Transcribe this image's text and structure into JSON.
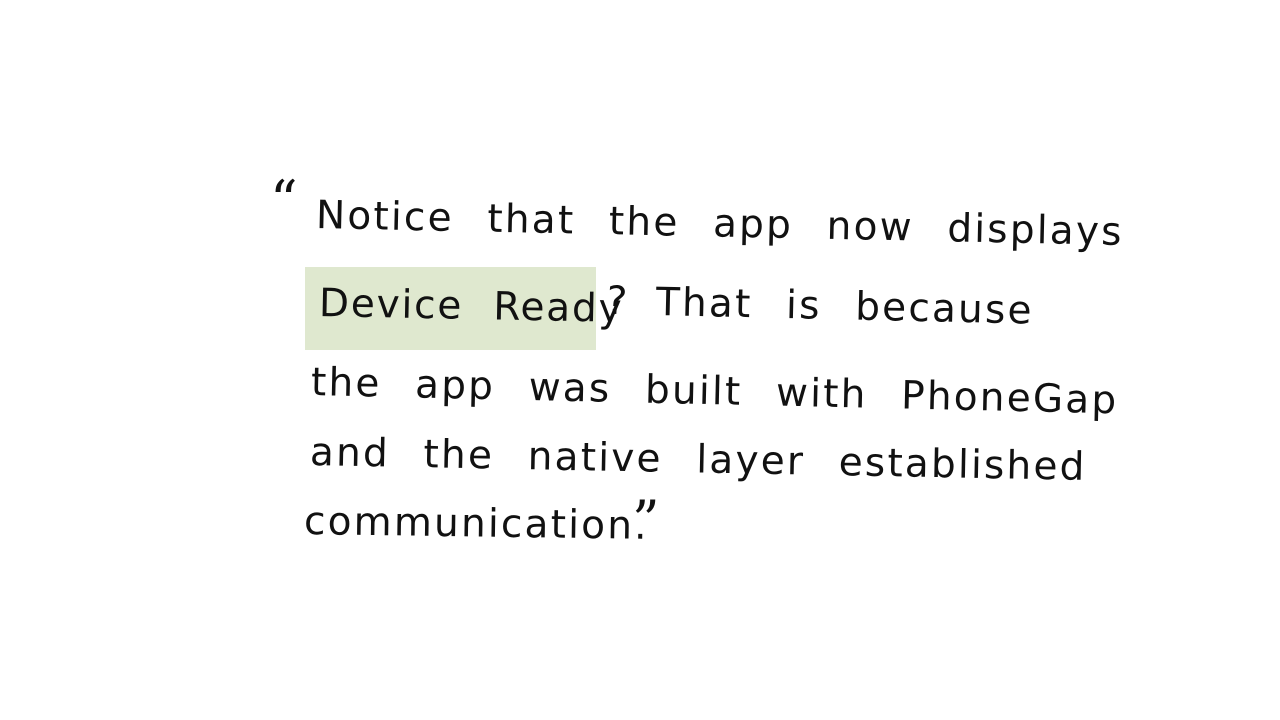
{
  "quote": {
    "open_mark": "“",
    "lines": [
      "Notice that the app now displays",
      "That is because",
      "the app was built with PhoneGap",
      "and the native layer established",
      "communication."
    ],
    "highlight": "Device Ready",
    "question_mark": "?",
    "close_mark": "”",
    "highlight_color": "#dfe8cf"
  }
}
